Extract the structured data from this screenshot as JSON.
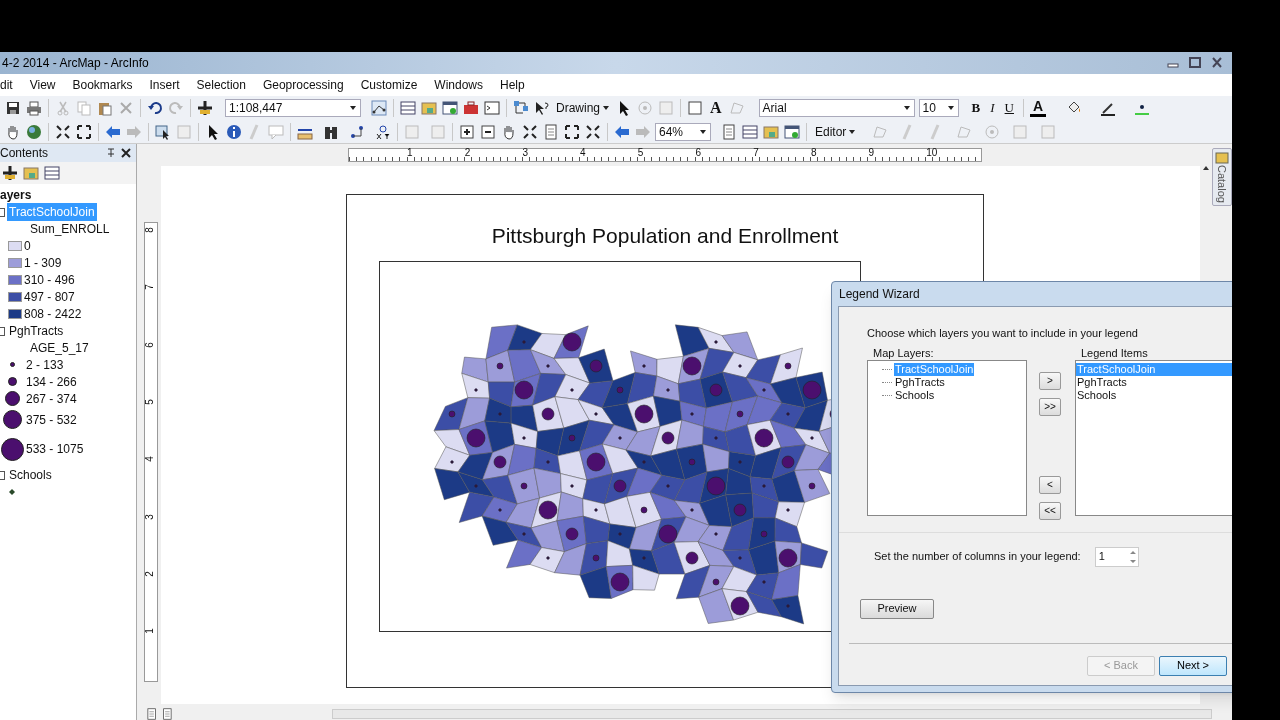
{
  "window": {
    "title": "4-2 2014 - ArcMap - ArcInfo"
  },
  "menu": [
    "dit",
    "View",
    "Bookmarks",
    "Insert",
    "Selection",
    "Geoprocessing",
    "Customize",
    "Windows",
    "Help"
  ],
  "toolbar": {
    "scale": "1:108,447",
    "drawing_menu": "Drawing",
    "font": "Arial",
    "font_size": "10",
    "bold": "B",
    "italic": "I",
    "underline": "U",
    "text_tool": "A",
    "font_color": "A",
    "zoom": "64%",
    "editor_menu": "Editor"
  },
  "toc": {
    "title": "Contents",
    "root": "ayers",
    "layers": [
      {
        "name": "TractSchoolJoin",
        "selected": true,
        "field": "Sum_ENROLL",
        "classes": [
          {
            "kind": "swatch",
            "label": "0",
            "color": "#dcdcf2"
          },
          {
            "kind": "swatch",
            "label": "1 - 309",
            "color": "#9c9cd9"
          },
          {
            "kind": "swatch",
            "label": "310 - 496",
            "color": "#6b70c6"
          },
          {
            "kind": "swatch",
            "label": "497 - 807",
            "color": "#3c4ea6"
          },
          {
            "kind": "swatch",
            "label": "808 - 2422",
            "color": "#1c3a86"
          }
        ]
      },
      {
        "name": "PghTracts",
        "selected": false,
        "field": "AGE_5_17",
        "classes": [
          {
            "kind": "circle",
            "label": "2 - 133"
          },
          {
            "kind": "circle",
            "label": "134 - 266"
          },
          {
            "kind": "circle",
            "label": "267 - 374"
          },
          {
            "kind": "circle",
            "label": "375 - 532"
          },
          {
            "kind": "circle",
            "label": "533 - 1075"
          }
        ]
      },
      {
        "name": "Schools",
        "selected": false,
        "classes": [
          {
            "kind": "dot"
          }
        ]
      }
    ]
  },
  "ruler": {
    "horizontal": [
      "1",
      "2",
      "3",
      "4",
      "5",
      "6",
      "7",
      "8",
      "9",
      "10"
    ],
    "vertical": [
      "8",
      "7",
      "6",
      "5",
      "4",
      "3",
      "2",
      "1"
    ]
  },
  "layout": {
    "title": "Pittsburgh Population and Enrollment"
  },
  "catalog_tab": "Catalog",
  "dialog": {
    "title": "Legend Wizard",
    "instruction": "Choose which layers you want to include in your legend",
    "map_layers_label": "Map Layers:",
    "map_layers": [
      {
        "name": "TractSchoolJoin",
        "selected": true
      },
      {
        "name": "PghTracts",
        "selected": false
      },
      {
        "name": "Schools",
        "selected": false
      }
    ],
    "legend_items_label": "Legend Items",
    "legend_items": [
      {
        "name": "TractSchoolJoin",
        "selected": true
      },
      {
        "name": "PghTracts",
        "selected": false
      },
      {
        "name": "Schools",
        "selected": false
      }
    ],
    "move_buttons": [
      ">",
      ">>",
      "<",
      "<<"
    ],
    "columns_label": "Set the number of columns in your legend:",
    "columns_value": "1",
    "preview": "Preview",
    "back": {
      "label": "< Back",
      "disabled": true
    },
    "next": {
      "label": "Next >",
      "disabled": false
    }
  }
}
